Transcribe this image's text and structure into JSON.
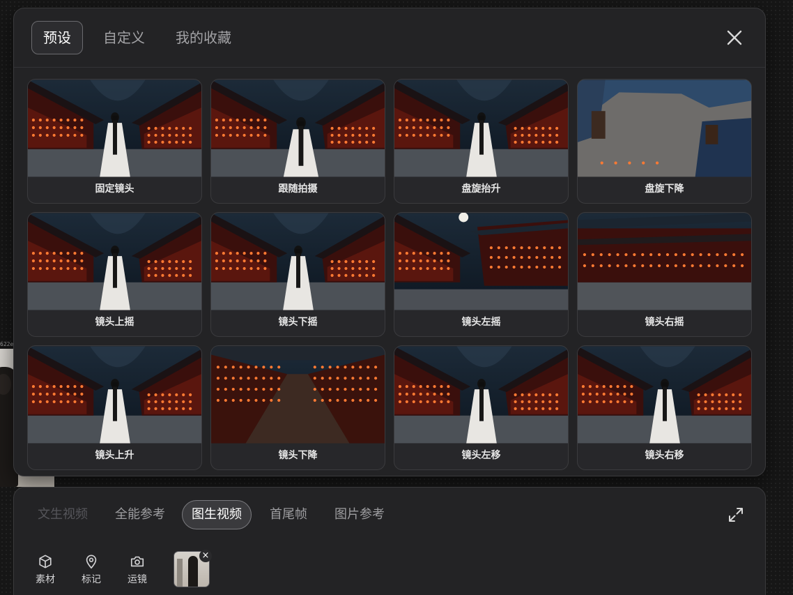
{
  "background": {
    "label": "622e"
  },
  "preset_panel": {
    "tabs": [
      {
        "label": "预设",
        "active": true
      },
      {
        "label": "自定义",
        "active": false
      },
      {
        "label": "我的收藏",
        "active": false
      }
    ],
    "close_icon": "close-icon",
    "presets": [
      {
        "label": "固定镜头",
        "scene": "girl-palace"
      },
      {
        "label": "跟随拍摄",
        "scene": "girl-palace-close"
      },
      {
        "label": "盘旋抬升",
        "scene": "girl-palace"
      },
      {
        "label": "盘旋下降",
        "scene": "aerial-roof"
      },
      {
        "label": "镜头上摇",
        "scene": "girl-palace"
      },
      {
        "label": "镜头下摇",
        "scene": "girl-palace"
      },
      {
        "label": "镜头左摇",
        "scene": "palace-moon"
      },
      {
        "label": "镜头右摇",
        "scene": "palace-wide"
      },
      {
        "label": "镜头上升",
        "scene": "girl-palace"
      },
      {
        "label": "镜头下降",
        "scene": "street-lanterns"
      },
      {
        "label": "镜头左移",
        "scene": "girl-palace"
      },
      {
        "label": "镜头右移",
        "scene": "girl-palace"
      }
    ]
  },
  "composer": {
    "modes": [
      {
        "label": "文生视频",
        "state": "disabled"
      },
      {
        "label": "全能参考",
        "state": "normal"
      },
      {
        "label": "图生视频",
        "state": "active"
      },
      {
        "label": "首尾帧",
        "state": "normal"
      },
      {
        "label": "图片参考",
        "state": "normal"
      }
    ],
    "expand_icon": "expand-icon",
    "tools": [
      {
        "label": "素材",
        "icon": "cube-icon"
      },
      {
        "label": "标记",
        "icon": "map-pin-icon"
      },
      {
        "label": "运镜",
        "icon": "camera-icon"
      }
    ],
    "attachment_remove": "×"
  },
  "colors": {
    "panel_bg": "#232325",
    "active_border": "#6b6b6f",
    "lantern": "#ff6a2a"
  }
}
